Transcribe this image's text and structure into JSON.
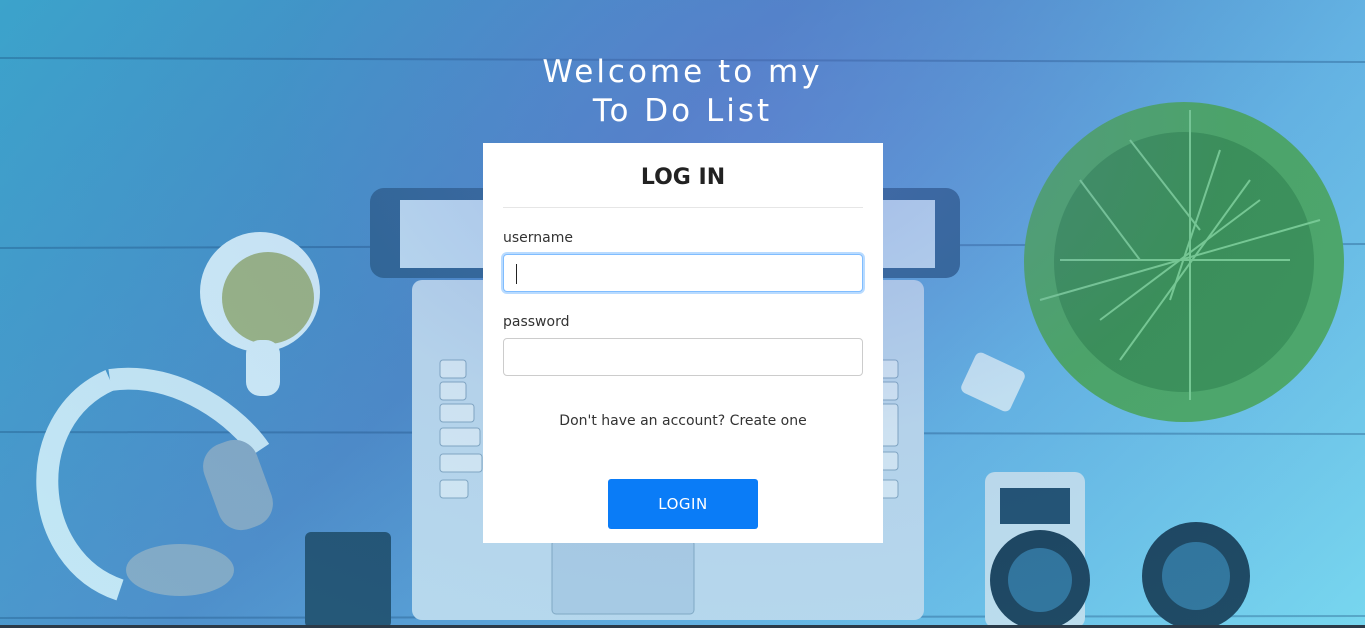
{
  "page": {
    "headline_line1": "Welcome to my",
    "headline_line2": "To Do List"
  },
  "login_card": {
    "title": "LOG IN",
    "username_label": "username",
    "username_value": "",
    "password_label": "password",
    "password_value": "",
    "signup_prompt": "Don't have an account?",
    "signup_link": "Create one",
    "submit_label": "LOGIN"
  },
  "colors": {
    "accent": "#0a7cf7",
    "card_background": "#ffffff",
    "focus_ring": "#80bdff"
  }
}
